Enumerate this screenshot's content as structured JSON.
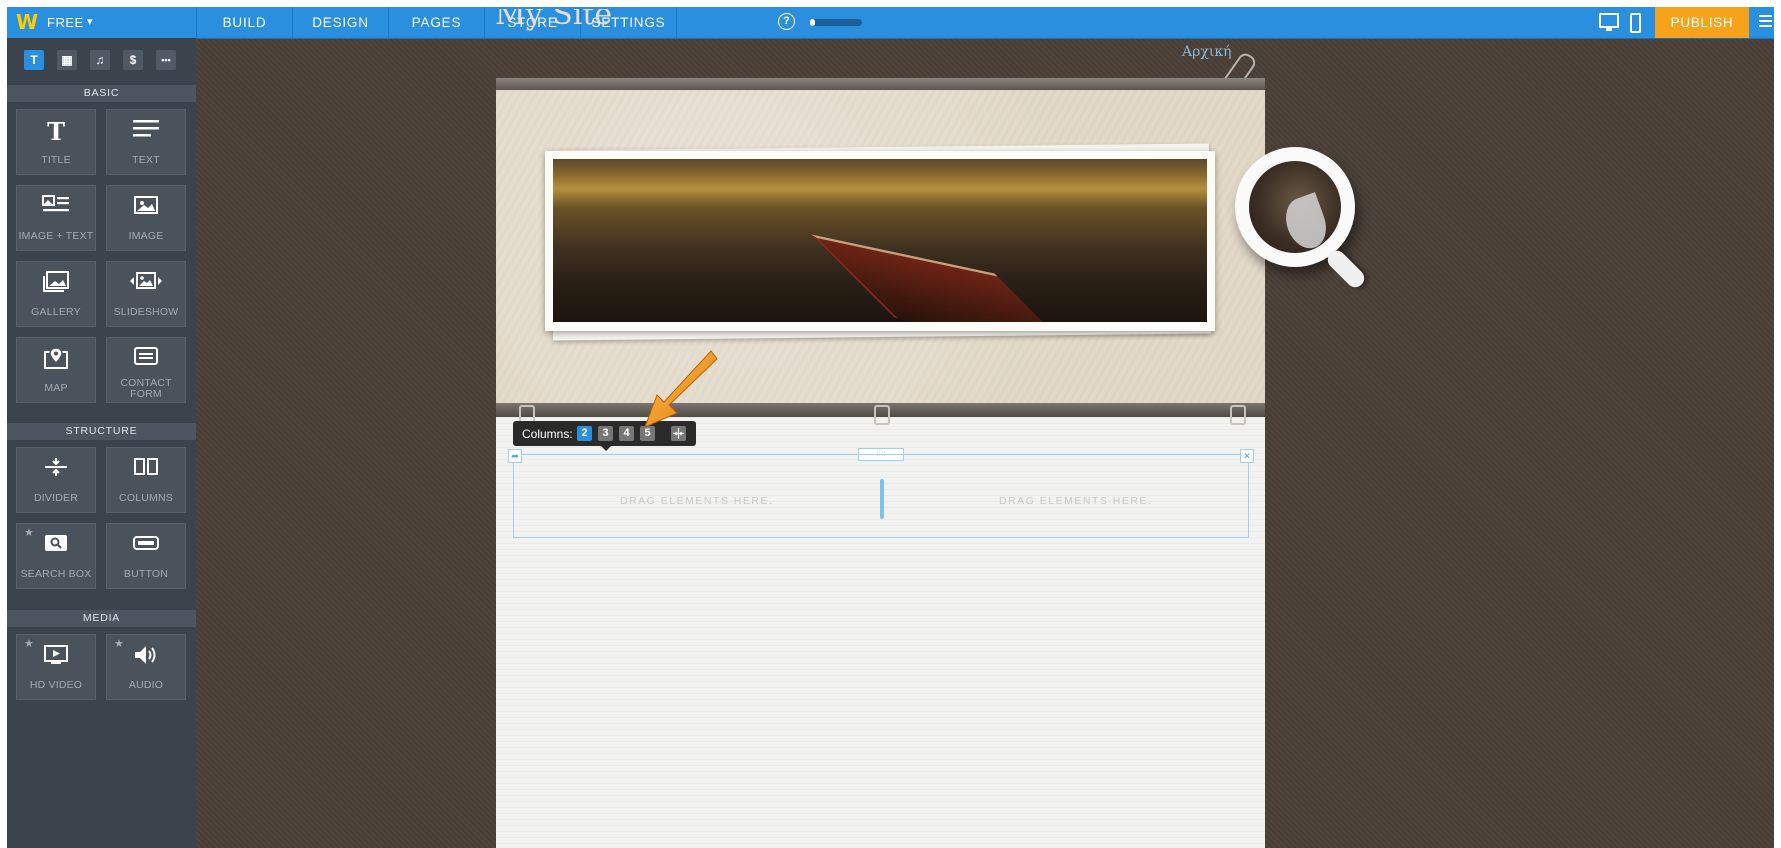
{
  "topbar": {
    "plan": "FREE",
    "tabs": [
      "BUILD",
      "DESIGN",
      "PAGES",
      "STORE",
      "SETTINGS"
    ],
    "help": "?",
    "progress": 0.1,
    "publish": "PUBLISH"
  },
  "sidebar": {
    "icon_tabs": [
      "T",
      "▦",
      "♫",
      "$",
      "•••"
    ],
    "sections": {
      "basic": "BASIC",
      "structure": "STRUCTURE",
      "media": "MEDIA"
    },
    "elements": {
      "title": "TITLE",
      "text": "TEXT",
      "image_text": "IMAGE + TEXT",
      "image": "IMAGE",
      "gallery": "GALLERY",
      "slideshow": "SLIDESHOW",
      "map": "MAP",
      "contact_form_1": "CONTACT",
      "contact_form_2": "FORM",
      "divider": "DIVIDER",
      "columns": "COLUMNS",
      "search_box": "SEARCH BOX",
      "button": "BUTTON",
      "hd_video": "HD VIDEO",
      "audio": "AUDIO"
    }
  },
  "site": {
    "title": "My Site",
    "nav_link": "Αρχική"
  },
  "columns_toolbar": {
    "label": "Columns:",
    "options": [
      "2",
      "3",
      "4",
      "5"
    ],
    "selected": "2"
  },
  "column_block": {
    "placeholder_left": "DRAG ELEMENTS HERE.",
    "placeholder_right": "DRAG ELEMENTS HERE."
  },
  "colors": {
    "topbar": "#2a8fde",
    "publish": "#f7a21c",
    "sidebar": "#3b444d",
    "accent_arrow": "#f39a1a"
  }
}
